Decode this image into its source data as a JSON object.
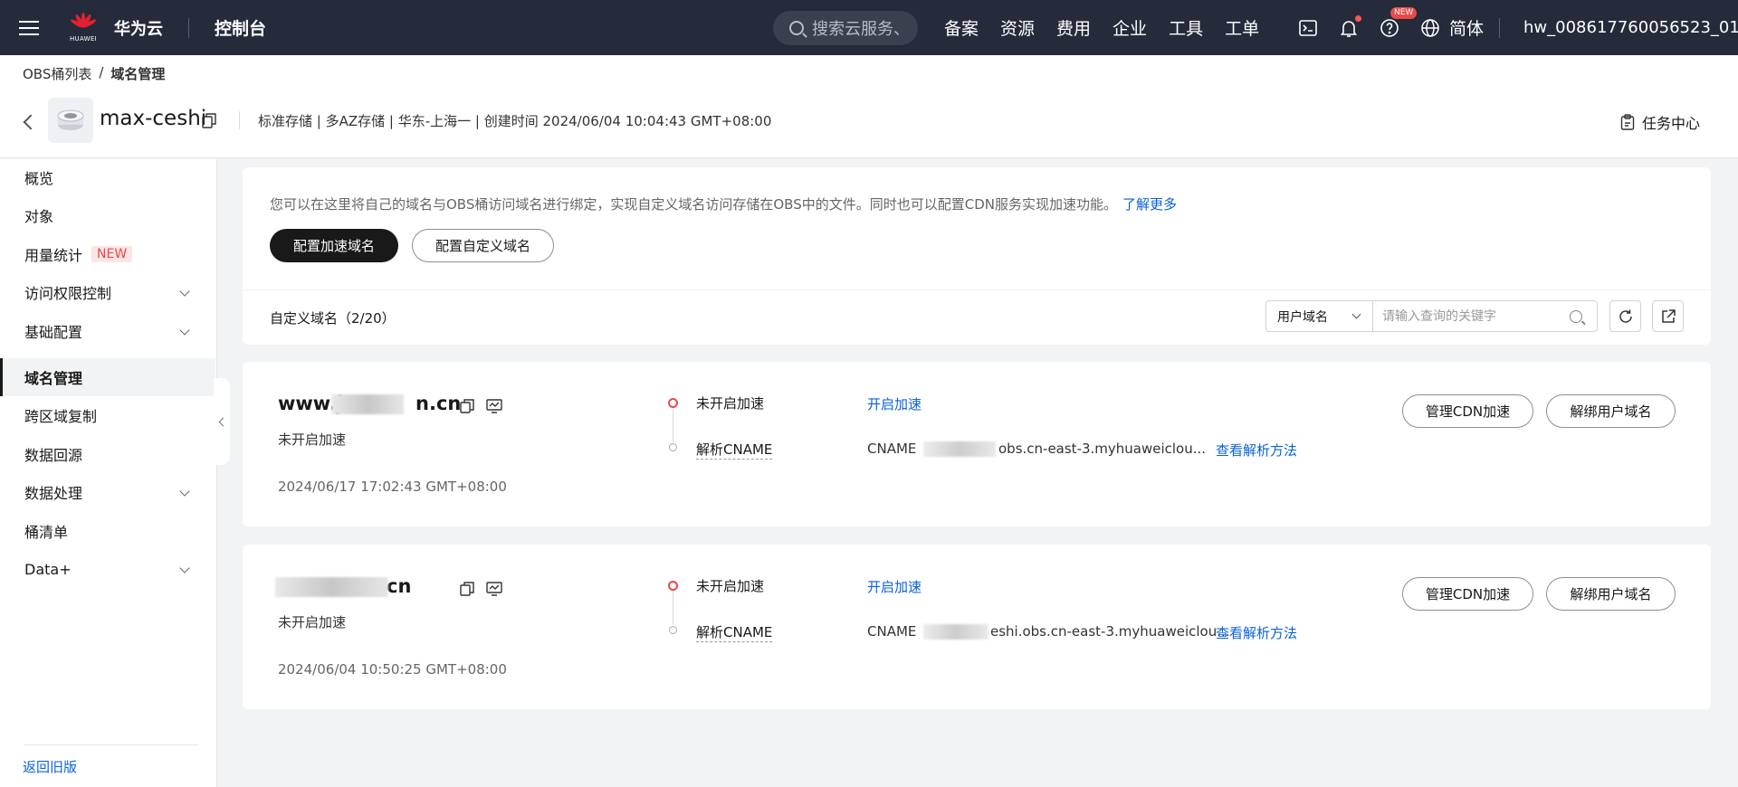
{
  "topbar": {
    "logo_small": "HUAWEI",
    "logo_text": "华为云",
    "console": "控制台",
    "search_placeholder": "搜索云服务、",
    "nav": [
      "备案",
      "资源",
      "费用",
      "企业",
      "工具",
      "工单"
    ],
    "new_badge": "NEW",
    "language": "简体",
    "username": "hw_008617760056523_01",
    "icons": [
      "menu-icon",
      "terminal-icon",
      "bell-icon",
      "help-icon",
      "globe-icon"
    ]
  },
  "breadcrumb": {
    "parent": "OBS桶列表",
    "separator": "/",
    "current": "域名管理"
  },
  "bucket": {
    "name": "max-ceshi",
    "meta": "标准存储 | 多AZ存储 | 华东-上海一 | 创建时间  2024/06/04 10:04:43 GMT+08:00",
    "task_center": "任务中心"
  },
  "sidebar": {
    "items": [
      {
        "label": "概览",
        "expandable": false
      },
      {
        "label": "对象",
        "expandable": false
      },
      {
        "label": "用量统计",
        "expandable": false,
        "tag": "NEW"
      },
      {
        "label": "访问权限控制",
        "expandable": true
      },
      {
        "label": "基础配置",
        "expandable": true
      },
      {
        "label": "域名管理",
        "expandable": false,
        "active": true
      },
      {
        "label": "跨区域复制",
        "expandable": false
      },
      {
        "label": "数据回源",
        "expandable": false
      },
      {
        "label": "数据处理",
        "expandable": true
      },
      {
        "label": "桶清单",
        "expandable": false
      },
      {
        "label": "Data+",
        "expandable": true
      }
    ],
    "back_old": "返回旧版"
  },
  "info": {
    "text": "您可以在这里将自己的域名与OBS桶访问域名进行绑定，实现自定义域名访问存储在OBS中的文件。同时也可以配置CDN服务实现加速功能。",
    "learn_more": "了解更多",
    "btn_accel": "配置加速域名",
    "btn_custom": "配置自定义域名"
  },
  "list": {
    "title": "自定义域名（2/20）",
    "filter_select": "用户域名",
    "filter_placeholder": "请输入查询的关键字"
  },
  "domains": [
    {
      "name_prefix": "www.j",
      "name_suffix": "n.cn",
      "status": "未开启加速",
      "created": "2024/06/17 17:02:43 GMT+08:00",
      "step1": "未开启加速",
      "step2": "解析CNAME",
      "enable": "开启加速",
      "cname_label": "CNAME",
      "cname_value": "obs.cn-east-3.myhuaweiclou...",
      "howto": "查看解析方法",
      "btn_manage": "管理CDN加速",
      "btn_unbind": "解绑用户域名"
    },
    {
      "name_prefix": "",
      "name_suffix": "cn",
      "status": "未开启加速",
      "created": "2024/06/04 10:50:25 GMT+08:00",
      "step1": "未开启加速",
      "step2": "解析CNAME",
      "enable": "开启加速",
      "cname_label": "CNAME",
      "cname_value": "eshi.obs.cn-east-3.myhuaweiclou...",
      "howto": "查看解析方法",
      "btn_manage": "管理CDN加速",
      "btn_unbind": "解绑用户域名"
    }
  ],
  "colors": {
    "topbar_bg": "#252b3a",
    "link": "#0a62d6",
    "primary_btn": "#191919",
    "alert_red": "#e84a4a"
  }
}
